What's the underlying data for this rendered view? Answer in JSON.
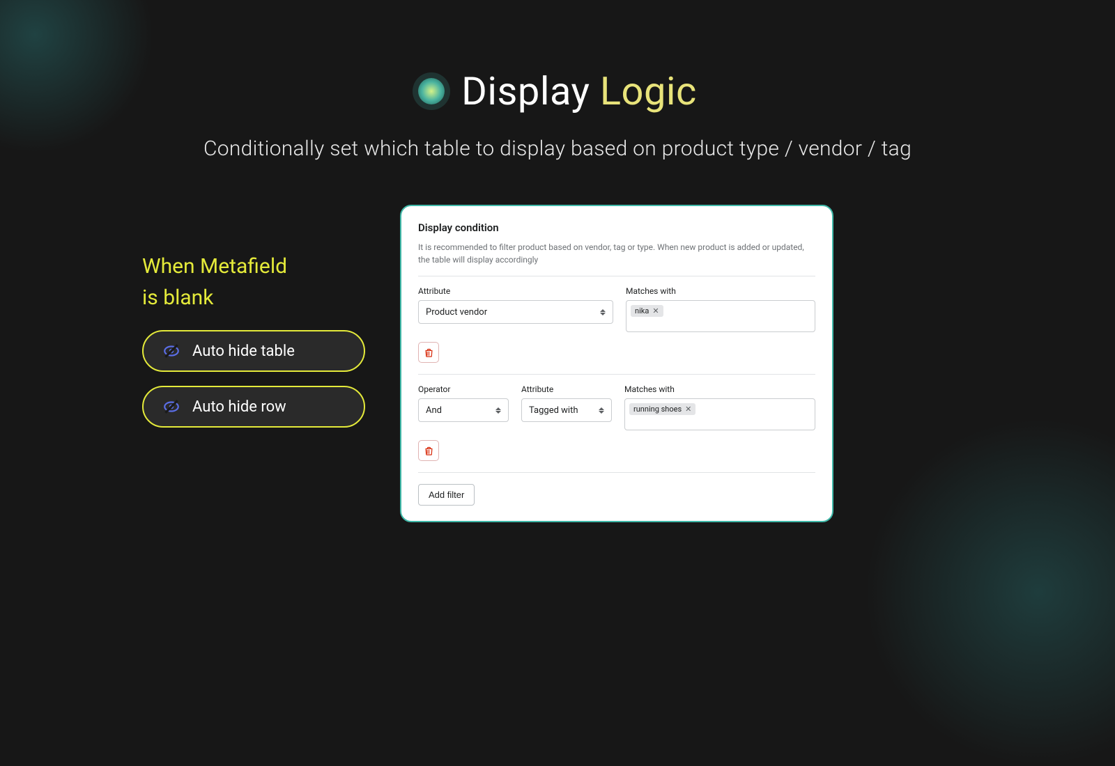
{
  "header": {
    "title_main": "Display",
    "title_accent": "Logic",
    "subtitle": "Conditionally set which table to display based on product type / vendor / tag"
  },
  "left": {
    "heading_line1": "When Metafield",
    "heading_line2": "is blank",
    "pill1": "Auto hide table",
    "pill2": "Auto hide row"
  },
  "card": {
    "title": "Display condition",
    "description": "It is recommended to filter product based on vendor, tag or type. When new product is added or updated, the table will display accordingly",
    "row1": {
      "attribute_label": "Attribute",
      "attribute_value": "Product vendor",
      "matches_label": "Matches with",
      "tag": "nika"
    },
    "row2": {
      "operator_label": "Operator",
      "operator_value": "And",
      "attribute_label": "Attribute",
      "attribute_value": "Tagged with",
      "matches_label": "Matches with",
      "tag": "running shoes"
    },
    "add_filter": "Add filter"
  }
}
